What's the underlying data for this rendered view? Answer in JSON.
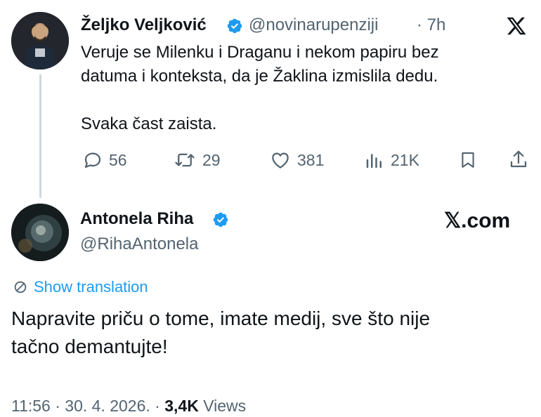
{
  "parent_tweet": {
    "author_name": "Željko Veljković",
    "handle": "@novinarupenziji",
    "time": "· 7h",
    "text": "Veruje se Milenku i Draganu i nekom papiru bez\ndatuma i konteksta, da je Žaklina izmislila dedu.\n\nSvaka čast zaista.",
    "replies": "56",
    "retweets": "29",
    "likes": "381",
    "views": "21K",
    "verified": true
  },
  "reply_tweet": {
    "author_name": "Antonela Riha",
    "handle": "@RihaAntonela",
    "show_translation": "Show translation",
    "text": "Napravite priču o tome, imate medij, sve što nije\ntačno demantujte!",
    "timestamp": "11:56 · 30. 4. 2026. · ",
    "views_count": "3,4K",
    "views_label": " Views",
    "verified": true
  },
  "watermark": "𝕏.com",
  "colors": {
    "text": "#0f1419",
    "secondary": "#536471",
    "accent": "#1d9bf0",
    "thread_line": "#cfd9de"
  },
  "icons": [
    "x-logo-icon",
    "verified-badge-icon",
    "reply-icon",
    "retweet-icon",
    "like-icon",
    "views-icon",
    "bookmark-icon",
    "share-icon",
    "translate-icon"
  ]
}
